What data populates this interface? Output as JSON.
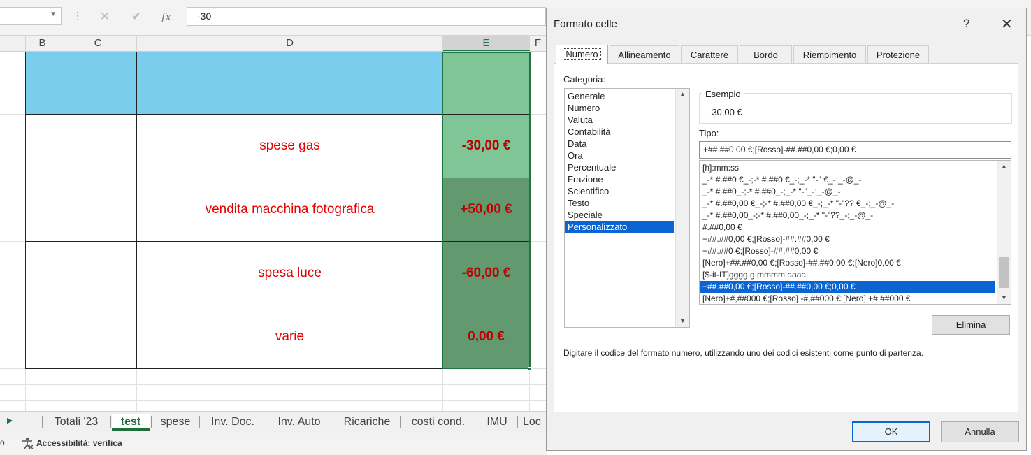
{
  "formula_bar": {
    "value": "-30",
    "cancel_glyph": "✕",
    "enter_glyph": "✔",
    "fx_label": "fx",
    "dots": "⋮"
  },
  "columns": [
    "B",
    "C",
    "D",
    "E",
    "F"
  ],
  "rows": [
    {
      "text": "spese gas",
      "value": "-30,00 €"
    },
    {
      "text": "vendita macchina fotografica",
      "value": "+50,00 €"
    },
    {
      "text": "spesa luce",
      "value": "-60,00 €"
    },
    {
      "text": "varie",
      "value": "0,00 €"
    }
  ],
  "colors": {
    "header_fill": "#7bcdee",
    "selected_light": "#7fc595",
    "selected_dark": "#62996f",
    "text_red": "#e60000",
    "accent_green": "#217346",
    "selection_blue": "#0a64d2"
  },
  "sheet_tabs": [
    "Totali '23",
    "test",
    "spese",
    "Inv. Doc.",
    "Inv. Auto",
    "Ricariche",
    "costi cond.",
    "IMU",
    "Loc"
  ],
  "active_tab": "test",
  "status": {
    "accessibility": "Accessibilità: verifica",
    "left_glyph": "o"
  },
  "dialog": {
    "title": "Formato celle",
    "help": "?",
    "close": "✕",
    "tabs": [
      "Numero",
      "Allineamento",
      "Carattere",
      "Bordo",
      "Riempimento",
      "Protezione"
    ],
    "category_label": "Categoria:",
    "categories": [
      "Generale",
      "Numero",
      "Valuta",
      "Contabilità",
      "Data",
      "Ora",
      "Percentuale",
      "Frazione",
      "Scientifico",
      "Testo",
      "Speciale",
      "Personalizzato"
    ],
    "selected_category": "Personalizzato",
    "esempio_label": "Esempio",
    "esempio_value": "-30,00 €",
    "tipo_label": "Tipo:",
    "tipo_value": "+##.##0,00 €;[Rosso]-##.##0,00 €;0,00 €",
    "format_codes": [
      "[h]:mm:ss",
      "_-* #.##0 €_-;-* #.##0 €_-;_-* \"-\" €_-;_-@_-",
      "_-* #.##0_-;-* #.##0_-;_-* \"-\"_-;_-@_-",
      "_-* #.##0,00 €_-;-* #.##0,00 €_-;_-* \"-\"?? €_-;_-@_-",
      "_-* #.##0,00_-;-* #.##0,00_-;_-* \"-\"??_-;_-@_-",
      "#.##0,00 €",
      "+##.##0,00 €;[Rosso]-##.##0,00 €",
      "+##.##0 €;[Rosso]-##.##0,00 €",
      "[Nero]+##.##0,00 €;[Rosso]-##.##0,00 €;[Nero]0,00 €",
      "[$-it-IT]gggg g mmmm aaaa",
      "+##.##0,00 €;[Rosso]-##.##0,00 €;0,00 €",
      "[Nero]+#,##000 €;[Rosso] -#,##000 €;[Nero] +#,##000 €"
    ],
    "selected_format_index": 10,
    "delete_button": "Elimina",
    "description": "Digitare il codice del formato numero, utilizzando uno dei codici esistenti come punto di partenza.",
    "ok_button": "OK",
    "cancel_button": "Annulla"
  }
}
